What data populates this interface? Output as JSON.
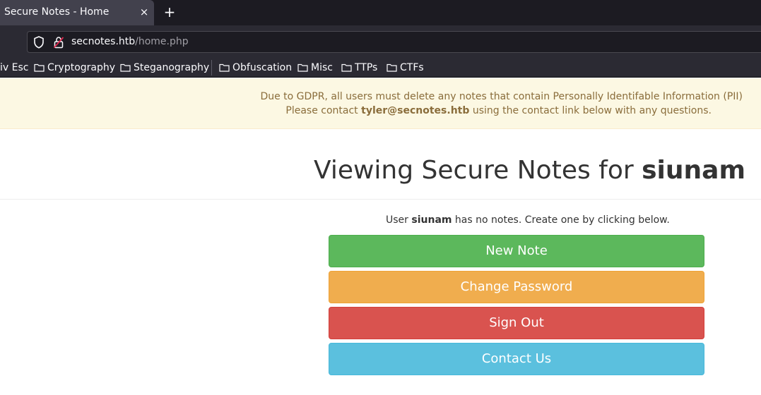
{
  "browser": {
    "tab": {
      "title": "Secure Notes - Home",
      "close_glyph": "×"
    },
    "new_tab_glyph": "+",
    "url": {
      "host": "secnotes.htb",
      "path": "/home.php"
    },
    "bookmarks": [
      {
        "label": "iv Esc",
        "folder": false
      },
      {
        "label": "Cryptography",
        "folder": true
      },
      {
        "label": "Steganography",
        "folder": true
      },
      {
        "label": "Obfuscation",
        "folder": true
      },
      {
        "label": "Misc",
        "folder": true
      },
      {
        "label": "TTPs",
        "folder": true
      },
      {
        "label": "CTFs",
        "folder": true
      }
    ]
  },
  "notice": {
    "line1": "Due to GDPR, all users must delete any notes that contain Personally Identifable Information (PII)",
    "line2_prefix": "Please contact ",
    "line2_email": "tyler@secnotes.htb",
    "line2_suffix": " using the contact link below with any questions."
  },
  "heading": {
    "prefix": "Viewing Secure Notes for ",
    "user": "siunam"
  },
  "info": {
    "prefix": "User ",
    "user": "siunam",
    "suffix": " has no notes. Create one by clicking below."
  },
  "buttons": {
    "new_note": "New Note",
    "change_password": "Change Password",
    "sign_out": "Sign Out",
    "contact_us": "Contact Us"
  },
  "colors": {
    "success": "#5cb85c",
    "warning": "#f0ad4e",
    "danger": "#d9534f",
    "info": "#5bc0de",
    "notice_bg": "#fcf8e3",
    "notice_text": "#8a6d3b"
  }
}
